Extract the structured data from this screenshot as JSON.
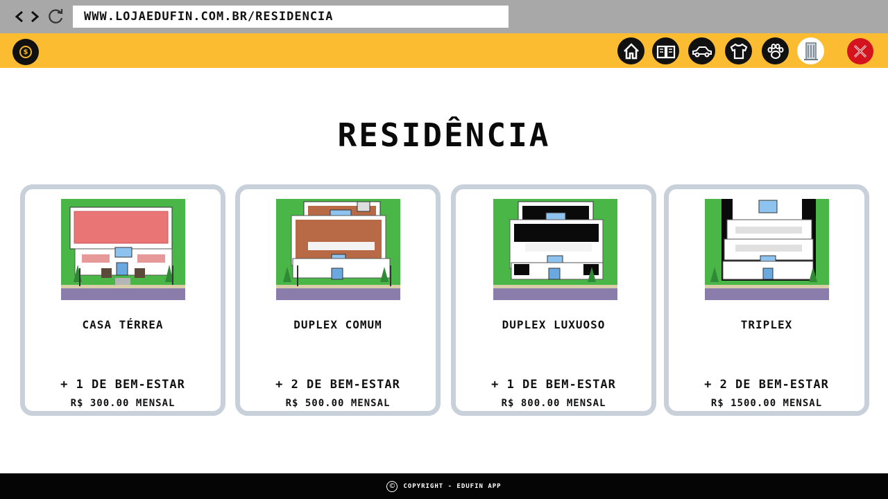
{
  "browser": {
    "url": "WWW.LOJAEDUFIN.COM.BR/RESIDENCIA"
  },
  "header": {
    "logo_icon": "coin-logo-icon",
    "categories": [
      {
        "name": "home",
        "icon": "home-icon",
        "active": false
      },
      {
        "name": "books",
        "icon": "book-icon",
        "active": false
      },
      {
        "name": "car",
        "icon": "car-icon",
        "active": false
      },
      {
        "name": "clothes",
        "icon": "shirt-icon",
        "active": false
      },
      {
        "name": "pets",
        "icon": "paw-icon",
        "active": false
      },
      {
        "name": "residence",
        "icon": "building-icon",
        "active": true
      }
    ],
    "close_icon": "close-icon",
    "colors": {
      "bar": "#fbbc32",
      "close": "#d3131d"
    }
  },
  "page": {
    "title": "RESIDÊNCIA"
  },
  "cards": [
    {
      "name": "CASA TÉRREA",
      "bonus": "+ 1 DE BEM-ESTAR",
      "price": "R$ 300.00 MENSAL"
    },
    {
      "name": "DUPLEX COMUM",
      "bonus": "+ 2 DE BEM-ESTAR",
      "price": "R$ 500.00 MENSAL"
    },
    {
      "name": "DUPLEX LUXUOSO",
      "bonus": "+ 1 DE BEM-ESTAR",
      "price": "R$ 800.00 MENSAL"
    },
    {
      "name": "TRIPLEX",
      "bonus": "+ 2 DE BEM-ESTAR",
      "price": "R$ 1500.00 MENSAL"
    }
  ],
  "footer": {
    "text": "COPYRIGHT - EDUFIN APP"
  }
}
